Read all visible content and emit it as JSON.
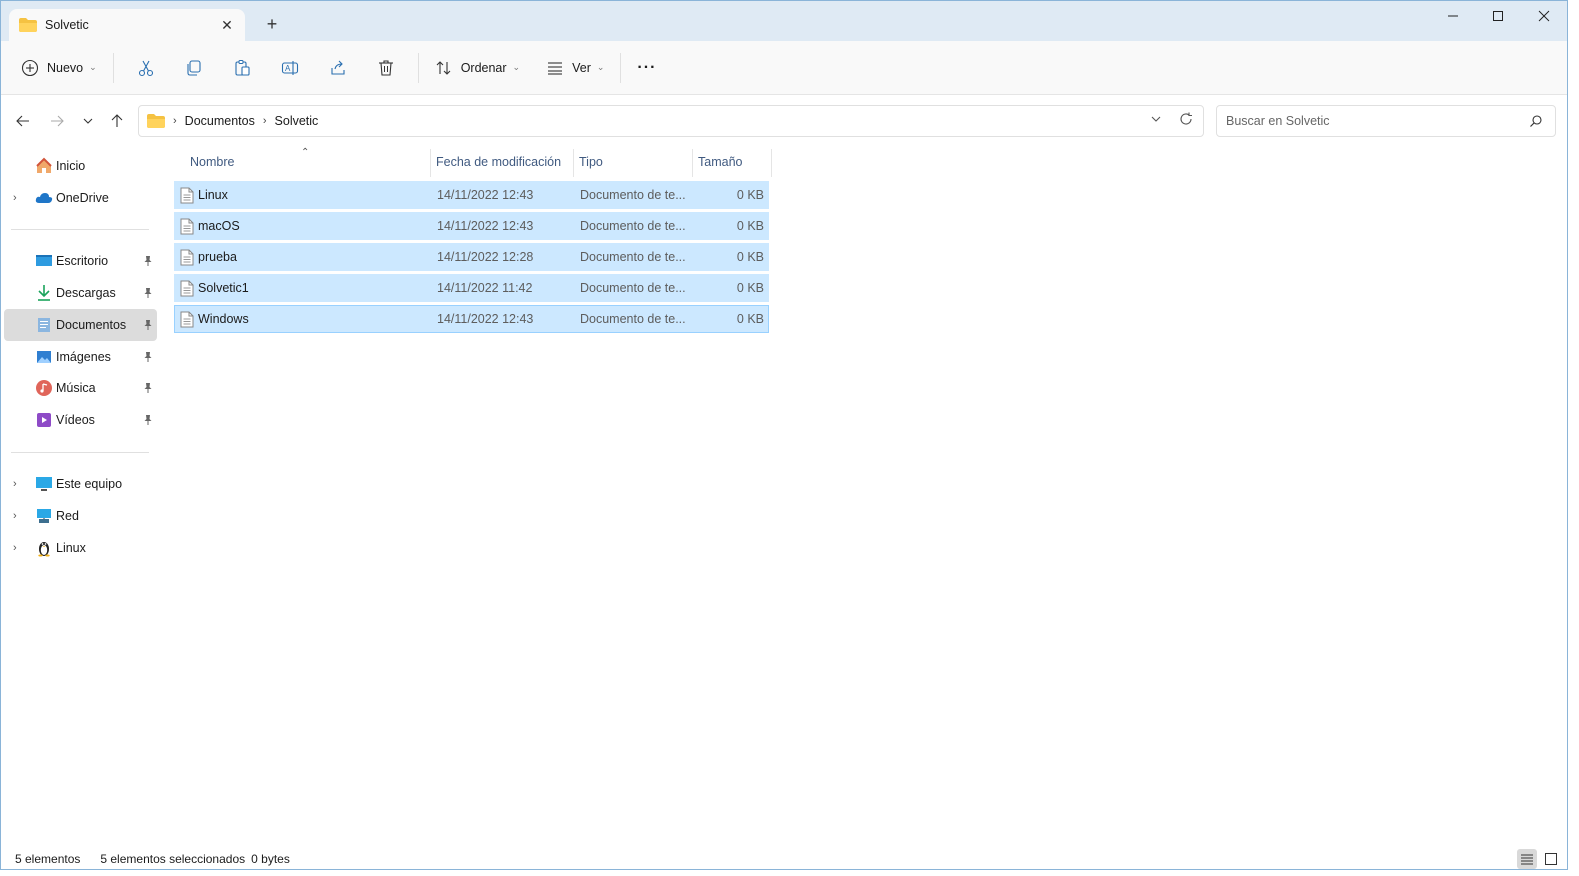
{
  "window": {
    "tab_title": "Solvetic",
    "new_tab_label": "+",
    "close_tab_glyph": "✕"
  },
  "toolbar": {
    "new_label": "Nuevo",
    "sort_label": "Ordenar",
    "view_label": "Ver",
    "more_label": "···",
    "icons": [
      "cut-icon",
      "copy-icon",
      "paste-icon",
      "rename-icon",
      "share-icon",
      "delete-icon"
    ]
  },
  "address": {
    "crumbs": [
      "Documentos",
      "Solvetic"
    ],
    "search_placeholder": "Buscar en Solvetic"
  },
  "sidebar": {
    "items": [
      {
        "label": "Inicio",
        "icon": "home-icon"
      },
      {
        "label": "OneDrive",
        "icon": "cloud-icon",
        "expandable": true
      },
      {
        "label": "Escritorio",
        "icon": "desktop-icon",
        "pinned": true
      },
      {
        "label": "Descargas",
        "icon": "download-icon",
        "pinned": true
      },
      {
        "label": "Documentos",
        "icon": "documents-icon",
        "pinned": true,
        "active": true
      },
      {
        "label": "Imágenes",
        "icon": "pictures-icon",
        "pinned": true
      },
      {
        "label": "Música",
        "icon": "music-icon",
        "pinned": true
      },
      {
        "label": "Vídeos",
        "icon": "videos-icon",
        "pinned": true
      },
      {
        "label": "Este equipo",
        "icon": "computer-icon",
        "expandable": true
      },
      {
        "label": "Red",
        "icon": "network-icon",
        "expandable": true
      },
      {
        "label": "Linux",
        "icon": "linux-icon",
        "expandable": true
      }
    ]
  },
  "filelist": {
    "columns": [
      "Nombre",
      "Fecha de modificación",
      "Tipo",
      "Tamaño"
    ],
    "rows": [
      {
        "name": "Linux",
        "date": "14/11/2022 12:43",
        "type": "Documento de te...",
        "size": "0 KB"
      },
      {
        "name": "macOS",
        "date": "14/11/2022 12:43",
        "type": "Documento de te...",
        "size": "0 KB"
      },
      {
        "name": "prueba",
        "date": "14/11/2022 12:28",
        "type": "Documento de te...",
        "size": "0 KB"
      },
      {
        "name": "Solvetic1",
        "date": "14/11/2022 11:42",
        "type": "Documento de te...",
        "size": "0 KB"
      },
      {
        "name": "Windows",
        "date": "14/11/2022 12:43",
        "type": "Documento de te...",
        "size": "0 KB"
      }
    ]
  },
  "status": {
    "count": "5 elementos",
    "selected": "5 elementos seleccionados",
    "size": "0 bytes"
  },
  "colors": {
    "selection": "#cce8ff",
    "titlebar": "#dfeaf4",
    "header_text": "#405a80"
  }
}
